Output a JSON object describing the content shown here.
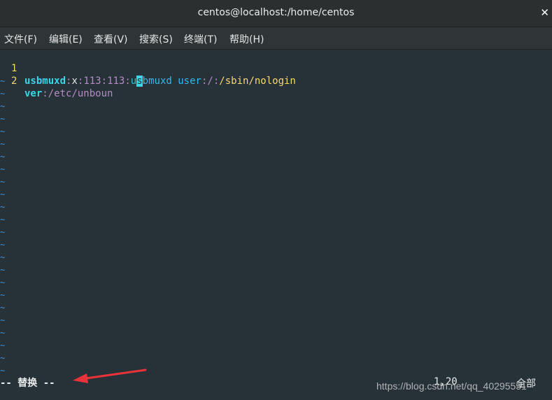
{
  "window": {
    "title": "centos@localhost:/home/centos",
    "close_glyph": "✕"
  },
  "menu": [
    "文件(F)",
    "编辑(E)",
    "查看(V)",
    "搜索(S)",
    "终端(T)",
    "帮助(H)"
  ],
  "editor": {
    "line1": {
      "number": "1",
      "user": "usbmuxd",
      "sep1": ":",
      "password": "x",
      "sep2": ":",
      "uid": "113",
      "sep3": ":",
      "gid": "113",
      "sep4": ":",
      "desc_pre": "u",
      "cursor_char": "s",
      "desc_post": "bmuxd user",
      "sep5": ":",
      "home": "/",
      "sep6": ":",
      "shell": "/sbin/nologin"
    },
    "line2": {
      "number": "2",
      "user": "ver",
      "sep1": ":",
      "rest": "/etc/unboun"
    },
    "tilde": "~"
  },
  "statusbar": {
    "mode": "-- 替换 --",
    "position": "1,20",
    "scope": "全部"
  },
  "watermark": "https://blog.csdn.net/qq_40295551",
  "colors": {
    "background": "#263238",
    "accent_cyan": "#38d6e6",
    "line_number_yellow": "#f7d774",
    "tilde_blue": "#3f8fd6",
    "arrow_red": "#e8333a"
  }
}
